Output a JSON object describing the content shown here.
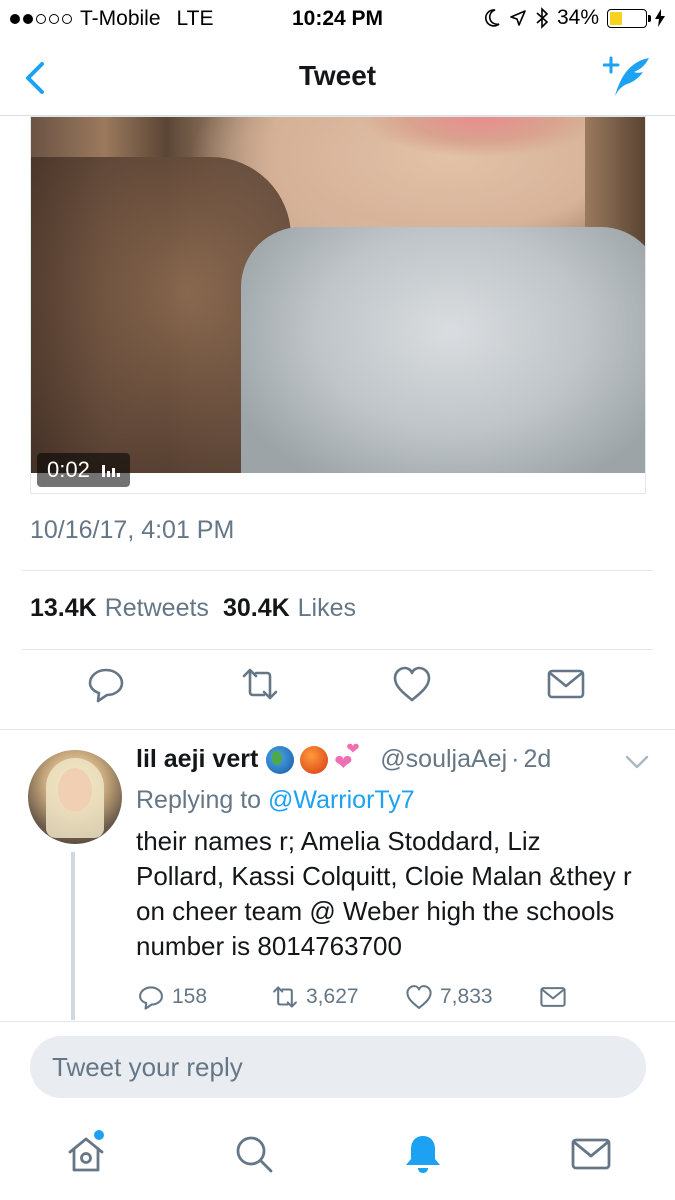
{
  "status_bar": {
    "carrier": "T-Mobile",
    "network": "LTE",
    "time": "10:24 PM",
    "battery_percent_text": "34%",
    "battery_level": 0.34,
    "battery_color": "#f7d21e"
  },
  "nav": {
    "back_icon": "chevron-left-icon",
    "title": "Tweet",
    "compose_icon": "compose-tweet-icon"
  },
  "video": {
    "duration": "0:02"
  },
  "tweet": {
    "timestamp": "10/16/17, 4:01 PM",
    "retweets_count": "13.4K",
    "retweets_label": "Retweets",
    "likes_count": "30.4K",
    "likes_label": "Likes",
    "actions": [
      "reply-icon",
      "retweet-icon",
      "like-icon",
      "dm-icon"
    ]
  },
  "reply": {
    "name": "lil aeji vert",
    "handle": "@souljaAej",
    "separator": "·",
    "age": "2d",
    "replying_prefix": "Replying to",
    "replying_to": "@WarriorTy7",
    "text": "their names r; Amelia Stoddard, Liz Pollard, Kassi Colquitt, Cloie Malan &they r on cheer team @ Weber high the schools number is 8014763700",
    "reply_count": "158",
    "retweet_count": "3,627",
    "like_count": "7,833"
  },
  "composer": {
    "placeholder": "Tweet your reply"
  },
  "tabs": [
    "home-icon",
    "search-icon",
    "notifications-icon",
    "messages-icon"
  ],
  "colors": {
    "accent": "#1da1f2",
    "text": "#14171a",
    "muted": "#657786"
  }
}
